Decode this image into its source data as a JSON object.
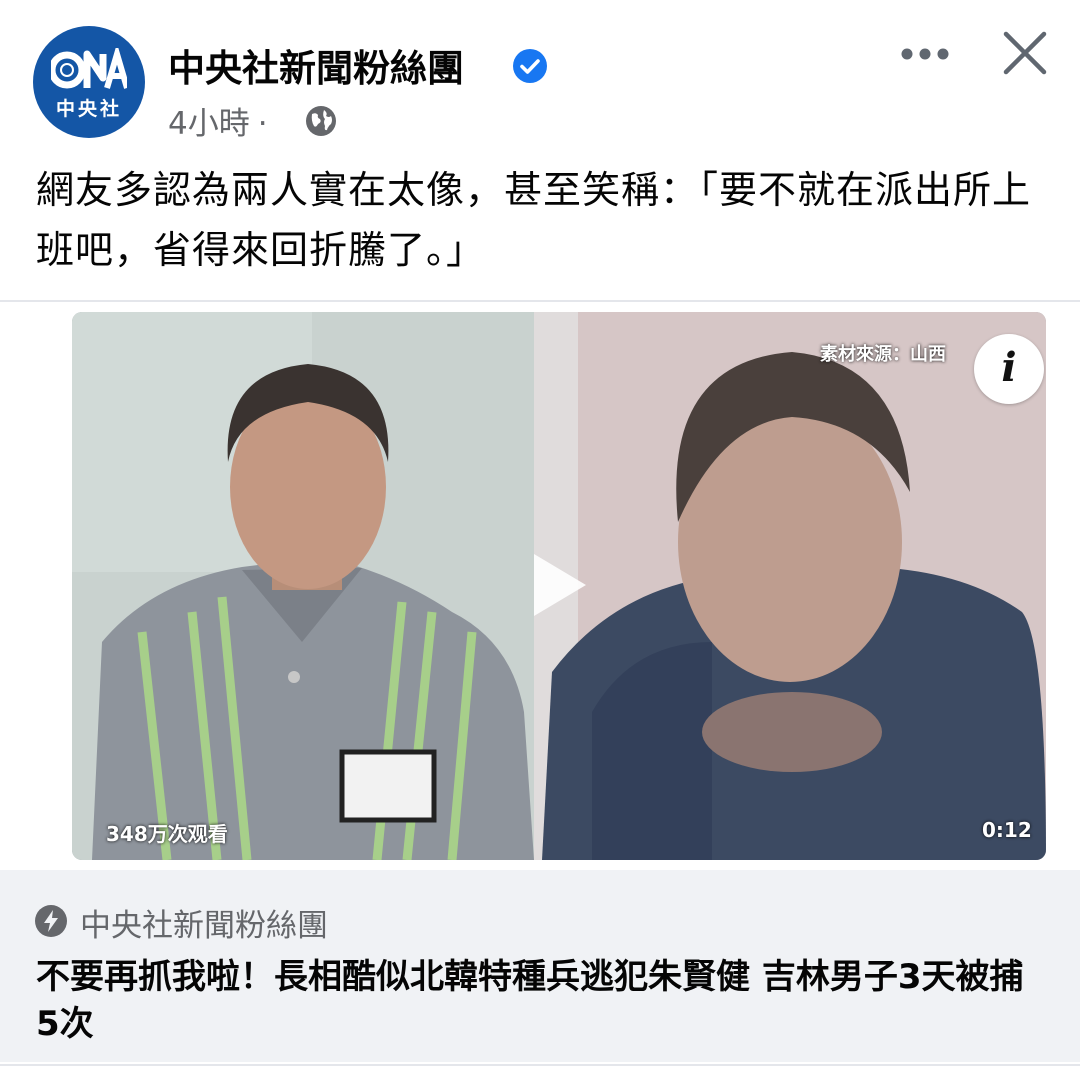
{
  "post": {
    "page_name": "中央社新聞粉絲團",
    "time": "4小時",
    "separator": "·",
    "avatar_text": "中央社",
    "avatar_logo": "CNA",
    "text": "網友多認為兩人實在太像，甚至笑稱：「要不就在派出所上班吧，省得來回折騰了。」"
  },
  "video": {
    "source_tag": "素材來源：山西",
    "views": "348万次观看",
    "duration": "0:12",
    "info_label": "i"
  },
  "link": {
    "source": "中央社新聞粉絲團",
    "title": "不要再抓我啦！長相酷似北韓特種兵逃犯朱賢健 吉林男子3天被捕5次"
  },
  "icons": {
    "verified": "verified-badge-icon",
    "globe": "globe-icon",
    "more": "more-options-icon",
    "close": "close-icon",
    "play": "play-icon",
    "bolt": "instant-article-bolt-icon"
  },
  "colors": {
    "brand_blue": "#1456a6",
    "verified_blue": "#1877f2",
    "secondary_text": "#65676b",
    "link_bg": "#f0f2f5"
  }
}
